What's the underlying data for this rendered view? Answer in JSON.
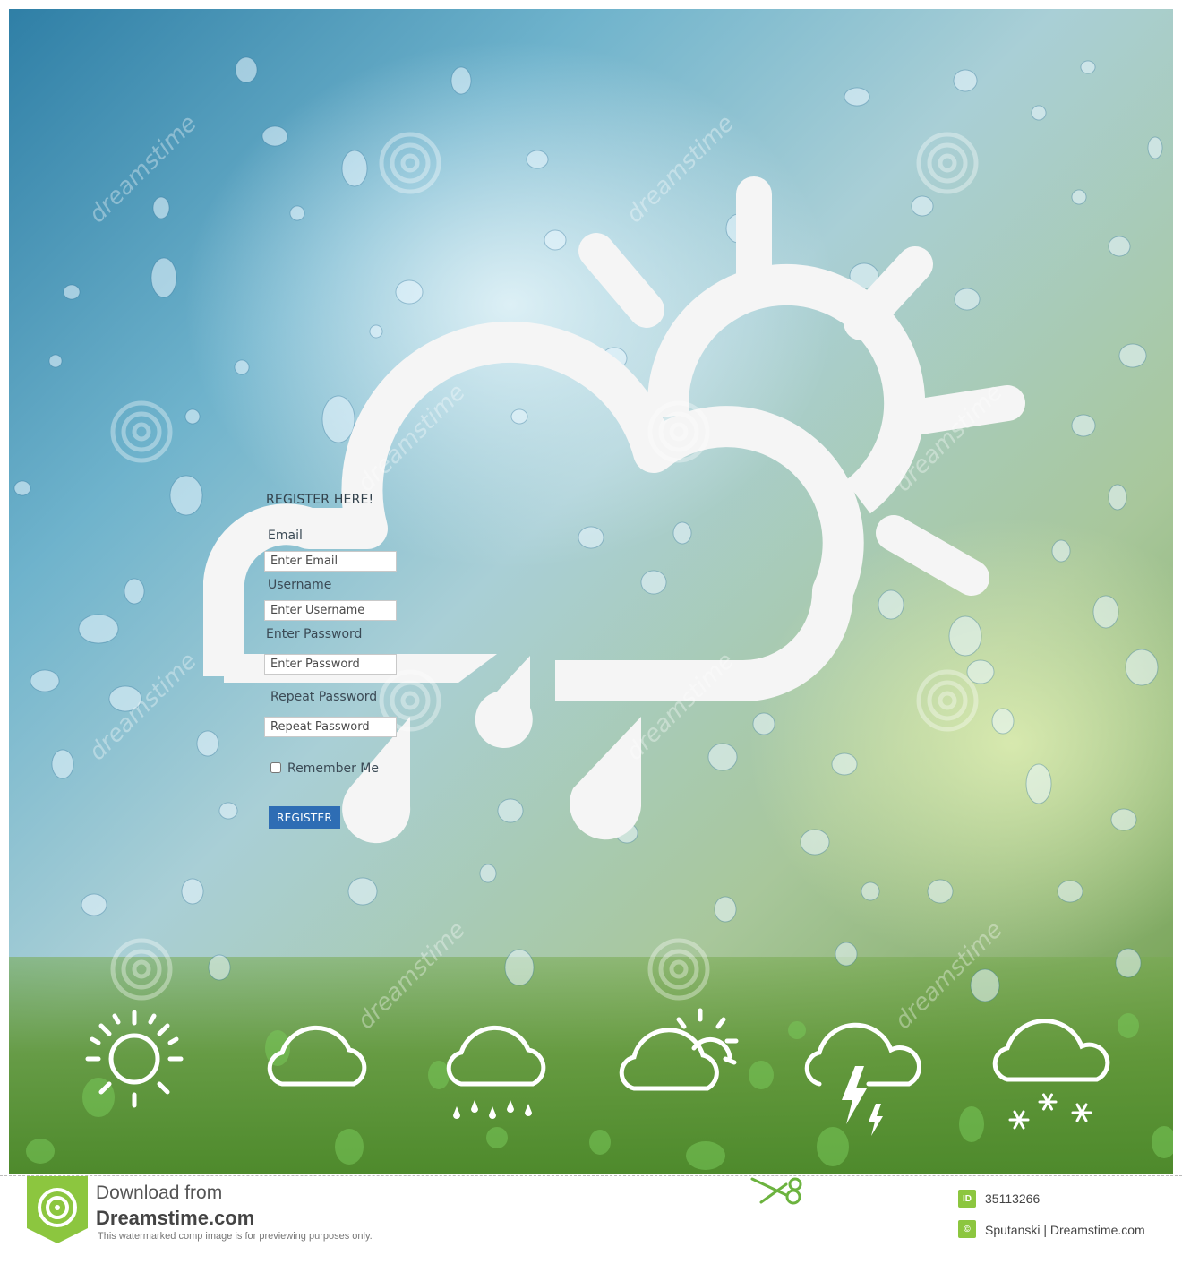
{
  "form": {
    "title": "REGISTER HERE!",
    "email_label": "Email",
    "email_placeholder": "Enter Email",
    "username_label": "Username",
    "username_placeholder": "Enter Username",
    "password_label": "Enter Password",
    "password_placeholder": "Enter Password",
    "repeat_label": "Repeat Password",
    "repeat_placeholder": "Repeat Password",
    "remember_label": "Remember Me",
    "remember_checked": false,
    "register_button": "REGISTER"
  },
  "hero_icon": "cloud-sun-rain-icon",
  "weather_icons": [
    "sun-icon",
    "cloud-icon",
    "cloud-rain-icon",
    "partly-cloudy-icon",
    "thunderstorm-icon",
    "snow-icon"
  ],
  "watermark": {
    "text": "dreamstime",
    "download_line1": "Download from",
    "download_line2": "Dreamstime.com",
    "notice": "This watermarked comp image is for previewing purposes only.",
    "id_badge": "ID",
    "image_id": "35113266",
    "copyright_badge": "©",
    "credit": "Sputanski | Dreamstime.com"
  },
  "colors": {
    "register_button": "#2e6db4",
    "dreamstime_green": "#8cc63f",
    "icon_white": "#f5f5f5"
  }
}
